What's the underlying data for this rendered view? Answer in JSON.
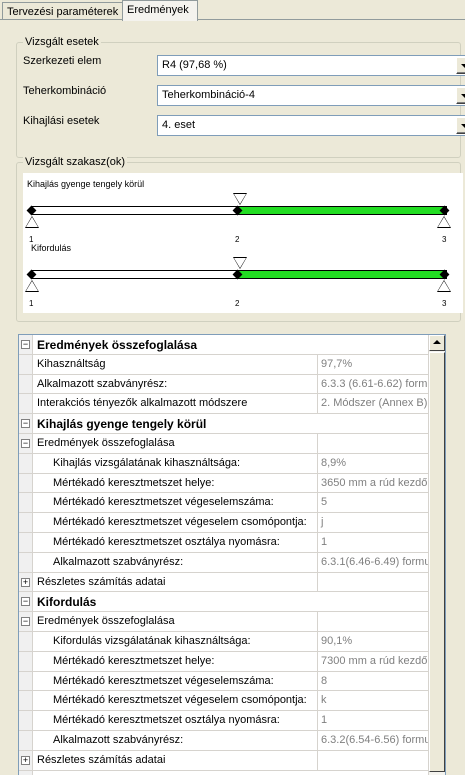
{
  "tabs": [
    {
      "label": "Tervezési paraméterek"
    },
    {
      "label": "Eredmények"
    }
  ],
  "examined_cases": {
    "legend": "Vizsgált esetek",
    "rows": [
      {
        "label": "Szerkezeti elem",
        "value": "R4 (97,68 %)"
      },
      {
        "label": "Teherkombináció",
        "value": "Teherkombináció-4"
      },
      {
        "label": "Kihajlási esetek",
        "value": "4. eset"
      }
    ]
  },
  "sections": {
    "legend": "Vizsgált szakasz(ok)",
    "diagram1": {
      "title": "Kihajlás gyenge tengely körül",
      "nodes": [
        "1",
        "2",
        "3"
      ]
    },
    "diagram2": {
      "title": "Kifordulás",
      "nodes": [
        "1",
        "2",
        "3"
      ]
    }
  },
  "grid": {
    "rows": [
      {
        "type": "header",
        "label": "Eredmények összefoglalása",
        "value": ""
      },
      {
        "type": "item",
        "indent": 1,
        "label": "Kihasználtság",
        "value": "97,7%"
      },
      {
        "type": "item",
        "indent": 1,
        "label": "Alkalmazott szabványrész:",
        "value": "6.3.3 (6.61-6.62) formula"
      },
      {
        "type": "item",
        "indent": 1,
        "label": "Interakciós tényezők alkalmazott módszere",
        "value": "2. Módszer (Annex B)"
      },
      {
        "type": "header",
        "label": "Kihajlás gyenge tengely körül",
        "value": ""
      },
      {
        "type": "sub",
        "label": "Eredmények összefoglalása",
        "value": ""
      },
      {
        "type": "item",
        "indent": 2,
        "label": "Kihajlás vizsgálatának kihasználtsága:",
        "value": "8,9%"
      },
      {
        "type": "item",
        "indent": 2,
        "label": "Mértékadó keresztmetszet helye:",
        "value": "3650 mm a rúd kezdőpontj"
      },
      {
        "type": "item",
        "indent": 2,
        "label": "Mértékadó keresztmetszet végeselemszáma:",
        "value": "5"
      },
      {
        "type": "item",
        "indent": 2,
        "label": "Mértékadó keresztmetszet végeselem csomópontja:",
        "value": "j"
      },
      {
        "type": "item",
        "indent": 2,
        "label": "Mértékadó keresztmetszet osztálya nyomásra:",
        "value": "1"
      },
      {
        "type": "item",
        "indent": 2,
        "label": "Alkalmazott szabványrész:",
        "value": "6.3.1(6.46-6.49) formula"
      },
      {
        "type": "collapsed",
        "label": "Részletes számítás adatai",
        "value": ""
      },
      {
        "type": "header",
        "label": "Kifordulás",
        "value": ""
      },
      {
        "type": "sub",
        "label": "Eredmények összefoglalása",
        "value": ""
      },
      {
        "type": "item",
        "indent": 2,
        "label": "Kifordulás vizsgálatának kihasználtsága:",
        "value": "90,1%"
      },
      {
        "type": "item",
        "indent": 2,
        "label": "Mértékadó keresztmetszet helye:",
        "value": "7300 mm a rúd kezdőpontj"
      },
      {
        "type": "item",
        "indent": 2,
        "label": "Mértékadó keresztmetszet végeselemszáma:",
        "value": "8"
      },
      {
        "type": "item",
        "indent": 2,
        "label": "Mértékadó keresztmetszet végeselem csomópontja:",
        "value": "k"
      },
      {
        "type": "item",
        "indent": 2,
        "label": "Mértékadó keresztmetszet osztálya nyomásra:",
        "value": "1"
      },
      {
        "type": "item",
        "indent": 2,
        "label": "Alkalmazott szabványrész:",
        "value": "6.3.2(6.54-6.56) formula"
      },
      {
        "type": "collapsed",
        "label": "Részletes számítás adatai",
        "value": ""
      }
    ]
  },
  "colors": {
    "highlight_segment": "#22dd22"
  }
}
